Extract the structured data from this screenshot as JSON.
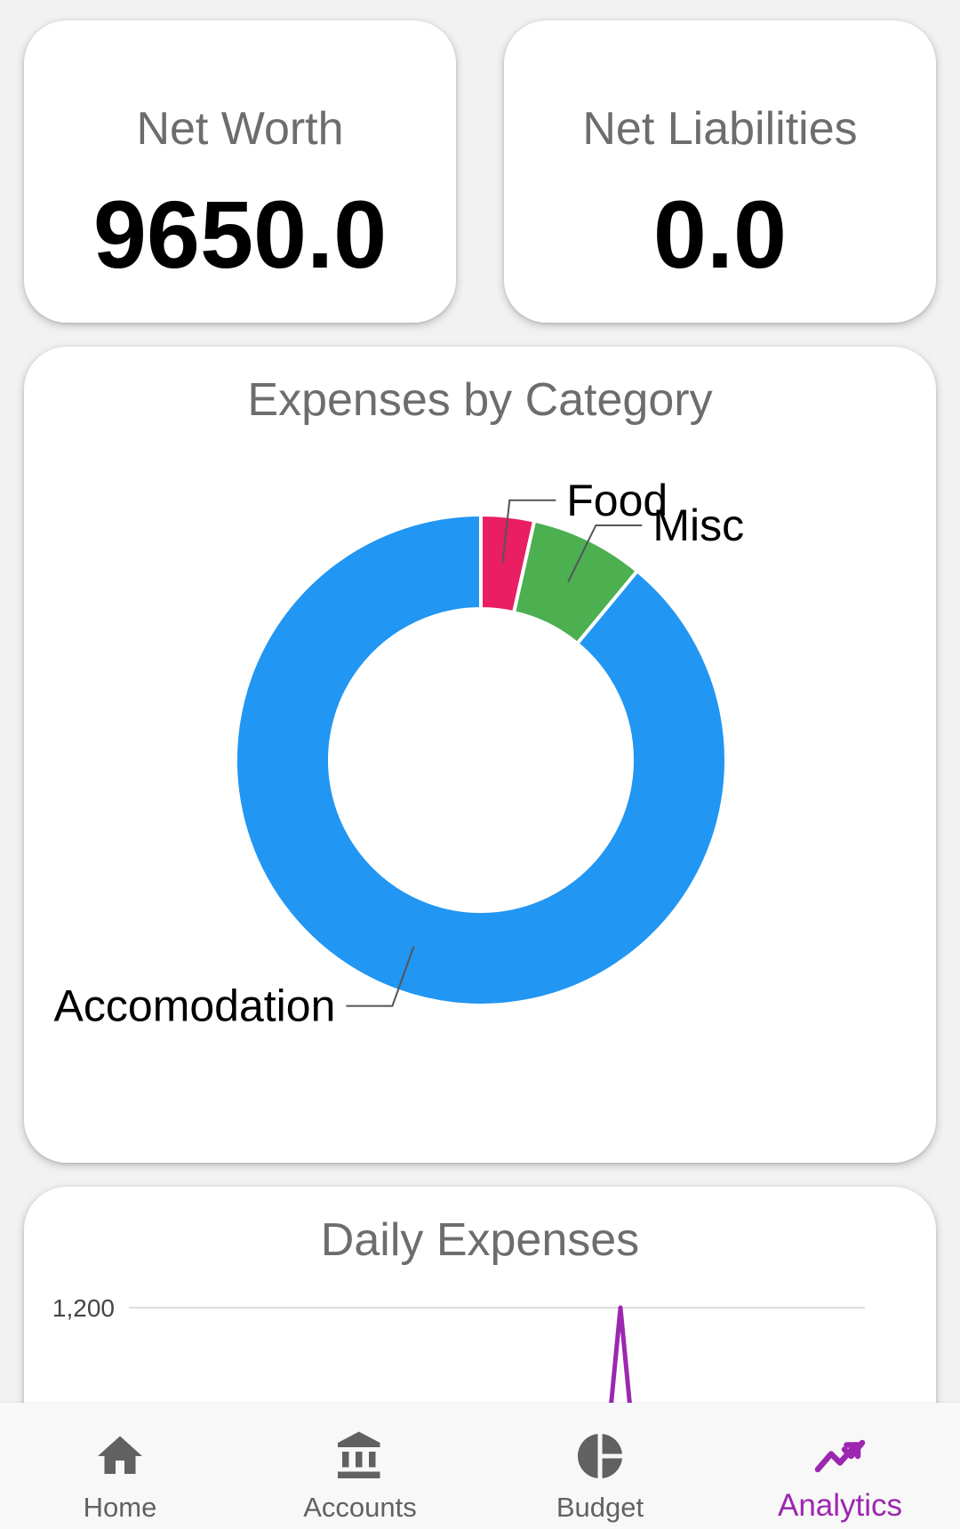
{
  "stats": {
    "net_worth": {
      "label": "Net Worth",
      "value": "9650.0"
    },
    "net_liabilities": {
      "label": "Net Liabilities",
      "value": "0.0"
    }
  },
  "expenses_by_category": {
    "title": "Expenses by Category",
    "chart_data": {
      "type": "pie",
      "style": "donut",
      "slices": [
        {
          "label": "Food",
          "percent": 3.5,
          "color": "#e91e63"
        },
        {
          "label": "Misc",
          "percent": 7.5,
          "color": "#4caf50"
        },
        {
          "label": "Accomodation",
          "percent": 89.0,
          "color": "#2196f3"
        }
      ]
    }
  },
  "daily_expenses": {
    "title": "Daily Expenses",
    "chart_data": {
      "type": "line",
      "y_tick_labels": [
        "1,200"
      ],
      "series_color": "#9c27b0",
      "grid": true
    }
  },
  "bottom_nav": {
    "items": [
      {
        "label": "Home",
        "icon": "home-icon",
        "active": false
      },
      {
        "label": "Accounts",
        "icon": "bank-icon",
        "active": false
      },
      {
        "label": "Budget",
        "icon": "pie-chart-icon",
        "active": false
      },
      {
        "label": "Analytics",
        "icon": "trending-up-icon",
        "active": true
      }
    ],
    "active_color": "#9c27b0",
    "inactive_color": "#616161"
  }
}
